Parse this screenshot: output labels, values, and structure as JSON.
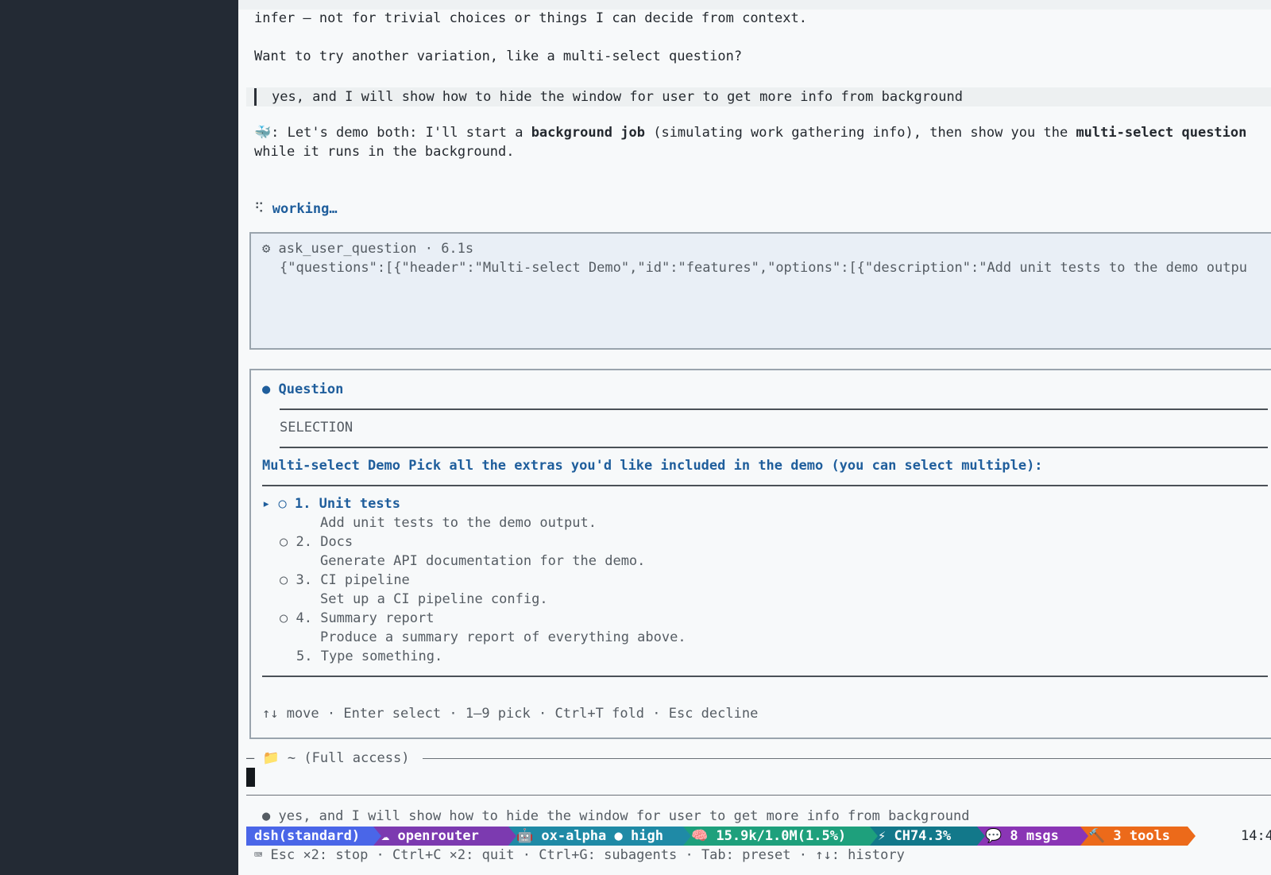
{
  "transcript": {
    "line1": "infer – not for trivial choices or things I can decide from context.",
    "line2": "Want to try another variation, like a multi-select question?",
    "user_message": "yes, and I will show how to hide the window for user to get more info from background",
    "assistant_icon": "🐳",
    "assistant_prefix": ": Let's demo both: I'll start a ",
    "assistant_bold1": "background job",
    "assistant_mid": " (simulating work gathering info), then show you the ",
    "assistant_bold2": "multi-select question",
    "assistant_line2": "while it runs in the background.",
    "spinner": "⠫",
    "working": "working…"
  },
  "tool_call": {
    "icon": "⚙",
    "name": "ask_user_question · 6.1s",
    "args": "{\"questions\":[{\"header\":\"Multi-select Demo\",\"id\":\"features\",\"options\":[{\"description\":\"Add unit tests to the demo outpu"
  },
  "question": {
    "dot": "●",
    "title": "Question",
    "section": "SELECTION",
    "prompt": "Multi-select Demo Pick all the extras you'd like included in the demo (you can select multiple):",
    "options": [
      {
        "marker": "▸ ○",
        "label": "1. Unit tests",
        "description": "Add unit tests to the demo output."
      },
      {
        "marker": "○",
        "label": "2. Docs",
        "description": "Generate API documentation for the demo."
      },
      {
        "marker": "○",
        "label": "3. CI pipeline",
        "description": "Set up a CI pipeline config."
      },
      {
        "marker": "○",
        "label": "4. Summary report",
        "description": "Produce a summary report of everything above."
      }
    ],
    "type_option": "5. Type something.",
    "hints": "↑↓ move · Enter select · 1–9 pick · Ctrl+T fold · Esc decline"
  },
  "input": {
    "folder_icon": "📁",
    "path_label": "~ (Full access)",
    "dash": "—"
  },
  "queued": {
    "dot": "●",
    "text": "yes, and I will show how to hide the window for user to get more info from background"
  },
  "statusbar": {
    "segments": [
      {
        "label": "dsh(standard)",
        "color": "#4a66e8"
      },
      {
        "label": "☁ openrouter",
        "color": "#7c3ab0"
      },
      {
        "label": "🤖 ox-alpha ● high",
        "color": "#1f8aa6"
      },
      {
        "label": "🧠 15.9k/1.0M(1.5%)",
        "color": "#1ea07c"
      },
      {
        "label": "⚡ CH74.3%",
        "color": "#12788a"
      },
      {
        "label": "💬 8 msgs",
        "color": "#8a35b5"
      },
      {
        "label": "🔨 3 tools",
        "color": "#ec6a1a"
      }
    ],
    "time": "14:4"
  },
  "keyhints": {
    "icon": "⌨",
    "text": "Esc ×2: stop · Ctrl+C ×2: quit · Ctrl+G: subagents · Tab: preset · ↑↓: history"
  }
}
